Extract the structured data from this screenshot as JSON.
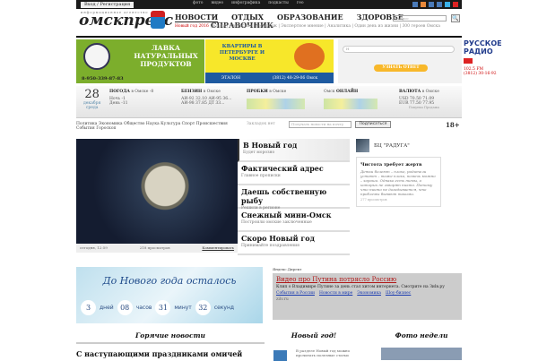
{
  "topbar": {
    "login": "Вход / Регистрация",
    "links": [
      "фото",
      "видео",
      "инфографика",
      "подкасты",
      "гео"
    ]
  },
  "header": {
    "logo": "омскпресс",
    "logo_sub": "информационное агентство",
    "nav": [
      "НОВОСТИ",
      "ОТДЫХ",
      "ОБРАЗОВАНИЕ",
      "ЗДОРОВЬЕ"
    ],
    "nav2": "СПРАВОЧНИК",
    "sub_highlight": "Новый год 2016",
    "sub": "Блоги | Авторские | Репортаж | Экспертное мнение | Аналитика | Один день из жизни | 300 героев Омска",
    "search_placeholder": "Запрос",
    "search_btn": "🔍"
  },
  "banners": {
    "lavka": "ЛАВКА НАТУРАЛЬНЫХ ПРОДУКТОВ",
    "lavka_phone": "8-950-339-87-83",
    "kvartiry": "КВАРТИРЫ В ПЕТЕРБУРГЕ И МОСКВЕ",
    "etalon": "ЭТАЛОН",
    "etalon_phone": "(3812) 48-29-06 Омск",
    "ask_placeholder": "Н",
    "ask_btn": "УЗНАТЬ ОТВЕТ",
    "radio": "РУССКОЕ РАДИО",
    "radio_fm": "102.5 FM",
    "radio_phone": "(3812) 30-16-92"
  },
  "strip": {
    "day": "28",
    "month": "декабря",
    "weekday": "среда",
    "weather_title": "ПОГОДА",
    "weather_city": "в Омске",
    "weather_now": "-8",
    "night": "Ночь -1",
    "day_t": "День -11",
    "fuel_title": "БЕНЗИН",
    "fuel_city": "в Омске",
    "fuel": [
      "АИ-92 32.10",
      "АИ-95 36...",
      "АИ-98 37.85",
      "ДТ 33..."
    ],
    "traffic_title": "ПРОБКИ",
    "traffic_city": "в Омске",
    "online_pre": "Омск",
    "online_title": "ОНЛАЙН",
    "cur_title": "ВАЛЮТА",
    "cur_city": "в Омске",
    "usd": "USD 70.50 71.09",
    "eur": "EUR 77.50 77.95",
    "cur_foot": "Покупка Продажа"
  },
  "rubrics": "Политика Экономика Общество Наука Культура Спорт Происшествия События Гороскоп",
  "bookmarks": "Закладок нет",
  "subscribe": {
    "placeholder": "Получать новости на почту",
    "button": "Подписаться"
  },
  "age": "18+",
  "photo_caption": {
    "date": "сегодня, 12:59",
    "views": "218 просмотров",
    "comment": "Комментировать"
  },
  "top_list": [
    {
      "title": "В Новый год",
      "sub": "Будет морозно"
    },
    {
      "title": "Фактический адрес",
      "sub": "Главное прописки"
    },
    {
      "title": "Даешь собственную рыбу",
      "sub": "Решили в регионе"
    },
    {
      "title": "Снежный мини-Омск",
      "sub": "Построили омские заключенные"
    },
    {
      "title": "Скоро Новый год",
      "sub": "Принимайте поздравления"
    }
  ],
  "right_col": {
    "name": "БЦ \"РАДУГА\"",
    "title": "Чистота требует жертв",
    "text": "Детки болеют – плохо, родители устают – тоже плохо, помочь можно – хорошо. Однако есть темы, о которых не говорят никто. Потому что никто не догадывается, что проблемы бывают такими.",
    "views": "277 просмотров"
  },
  "countdown": {
    "title": "До Нового года осталось",
    "days": "3",
    "days_l": "дней",
    "hours": "08",
    "hours_l": "часов",
    "min": "31",
    "min_l": "минут",
    "sec": "32",
    "sec_l": "секунд"
  },
  "direct": {
    "label": "Яндекс.Директ",
    "title": "Видео про Путина потрясло Россию",
    "text": "Клип о Владимире Путине за день стал хитом интернета. Смотрите на Зиlв.ру",
    "links": [
      "События в России",
      "Новости в мире",
      "Экономика",
      "Шоу-бизнес"
    ],
    "domain": "zilv.ru"
  },
  "sections": {
    "hot": "Горячие новости",
    "hot_first": "С наступающими праздниками омичей",
    "ny": "Новый год!",
    "ny_text": "В разделе Новый год можно прочитать полезные статьи",
    "photo_week": "Фото недели"
  }
}
